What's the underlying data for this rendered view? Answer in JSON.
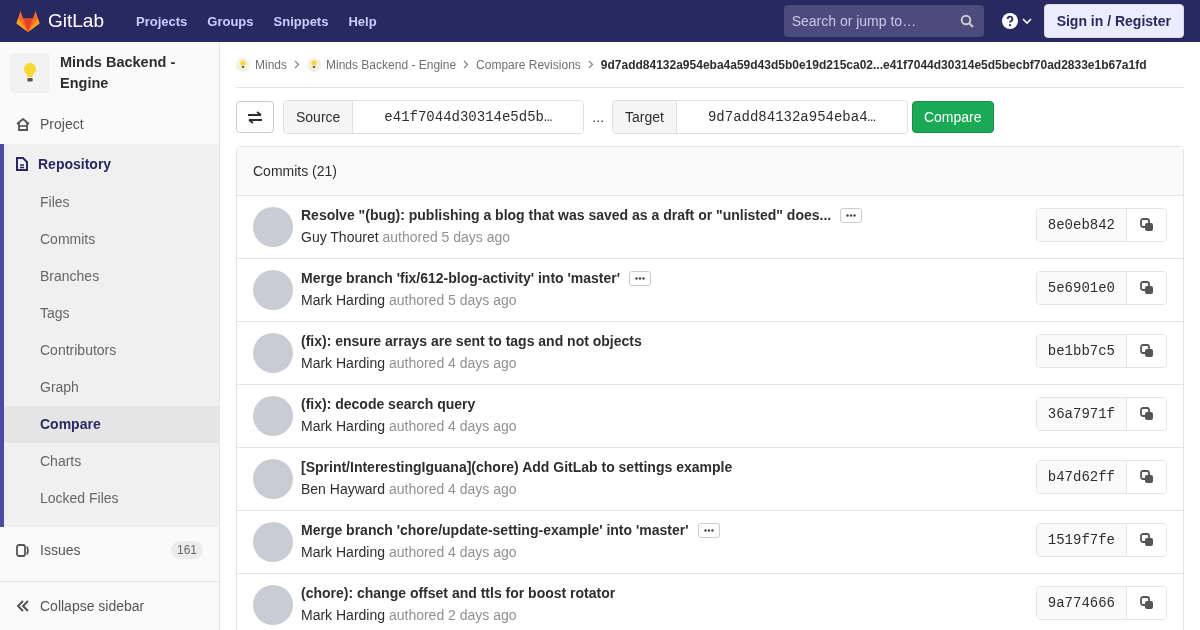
{
  "header": {
    "logo_text": "GitLab",
    "nav": [
      "Projects",
      "Groups",
      "Snippets",
      "Help"
    ],
    "search": {
      "placeholder": "Search or jump to…"
    },
    "sign_in": "Sign in / Register"
  },
  "sidebar": {
    "project_name": "Minds Backend - Engine",
    "items": [
      {
        "label": "Project",
        "selected": false
      },
      {
        "label": "Repository",
        "selected": true,
        "children": [
          {
            "label": "Files",
            "selected": false
          },
          {
            "label": "Commits",
            "selected": false
          },
          {
            "label": "Branches",
            "selected": false
          },
          {
            "label": "Tags",
            "selected": false
          },
          {
            "label": "Contributors",
            "selected": false
          },
          {
            "label": "Graph",
            "selected": false
          },
          {
            "label": "Compare",
            "selected": true
          },
          {
            "label": "Charts",
            "selected": false
          },
          {
            "label": "Locked Files",
            "selected": false
          }
        ]
      },
      {
        "label": "Issues",
        "selected": false,
        "count": "161"
      }
    ],
    "collapse": "Collapse sidebar"
  },
  "breadcrumbs": [
    {
      "label": "Minds",
      "icon": true
    },
    {
      "label": "Minds Backend - Engine",
      "icon": true
    },
    {
      "label": "Compare Revisions",
      "icon": false
    },
    {
      "label": "9d7add84132a954eba4a59d43d5b0e19d215ca02...e41f7044d30314e5d5becbf70ad2833e1b67a1fd",
      "icon": false
    }
  ],
  "compare": {
    "source_label": "Source",
    "source_value": "e41f7044d30314e5d5b…",
    "separator": "...",
    "target_label": "Target",
    "target_value": "9d7add84132a954eba4…",
    "button": "Compare"
  },
  "commits": {
    "title": "Commits (21)",
    "rows": [
      {
        "message": "Resolve \"(bug): publishing a blog that was saved as a draft or \"unlisted\" does...",
        "has_description": true,
        "author": "Guy Thouret",
        "time": "authored 5 days ago",
        "sha": "8e0eb842"
      },
      {
        "message": "Merge branch 'fix/612-blog-activity' into 'master'",
        "has_description": true,
        "author": "Mark Harding",
        "time": "authored 5 days ago",
        "sha": "5e6901e0"
      },
      {
        "message": "(fix): ensure arrays are sent to tags and not objects",
        "has_description": false,
        "author": "Mark Harding",
        "time": "authored 4 days ago",
        "sha": "be1bb7c5"
      },
      {
        "message": "(fix): decode search query",
        "has_description": false,
        "author": "Mark Harding",
        "time": "authored 4 days ago",
        "sha": "36a7971f"
      },
      {
        "message": "[Sprint/InterestingIguana](chore) Add GitLab to settings example",
        "has_description": false,
        "author": "Ben Hayward",
        "time": "authored 4 days ago",
        "sha": "b47d62ff"
      },
      {
        "message": "Merge branch 'chore/update-setting-example' into 'master'",
        "has_description": true,
        "author": "Mark Harding",
        "time": "authored 4 days ago",
        "sha": "1519f7fe"
      },
      {
        "message": "(chore): change offset and ttls for boost rotator",
        "has_description": false,
        "author": "Mark Harding",
        "time": "authored 2 days ago",
        "sha": "9a774666"
      }
    ]
  }
}
